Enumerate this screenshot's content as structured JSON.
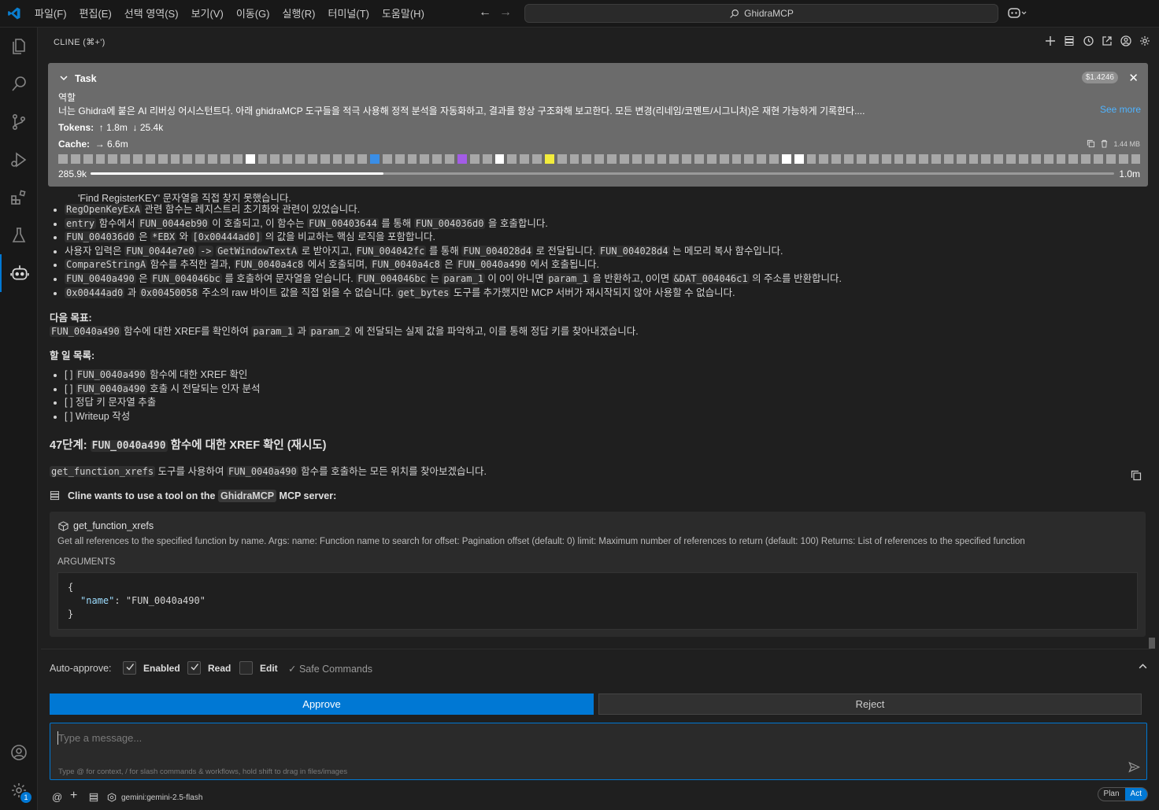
{
  "titlebar": {
    "menu": [
      "파일(F)",
      "편집(E)",
      "선택 영역(S)",
      "보기(V)",
      "이동(G)",
      "실행(R)",
      "터미널(T)",
      "도움말(H)"
    ],
    "search_text": "GhidraMCP"
  },
  "panel": {
    "title": "CLINE (⌘+')"
  },
  "task": {
    "title": "Task",
    "cost": "$1.4246",
    "role_label": "역할",
    "description": "너는 Ghidra에 붙은 AI 리버싱 어시스턴트다. 아래 ghidraMCP 도구들을 적극 사용해 정적 분석을 자동화하고, 결과를 항상 구조화해 보고한다. 모든 변경(리네임/코멘트/시그니처)은 재현 가능하게 기록한다....",
    "see_more": "See more",
    "tokens_label": "Tokens:",
    "tokens_up": "1.8m",
    "tokens_down": "25.4k",
    "cache_label": "Cache:",
    "cache_value": "6.6m",
    "size": "1.44 MB",
    "progress_left": "285.9k",
    "progress_right": "1.0m",
    "progress_fraction": 0.286,
    "block_colors": {
      "white": [
        15,
        35,
        58,
        59
      ],
      "blue": 25,
      "purple": 32,
      "yellow": 39
    }
  },
  "chat": {
    "truncated_line": "'Find RegisterKEY' 문자열을 직접 찾지 못했습니다.",
    "bullets": [
      [
        {
          "c": "RegOpenKeyExA"
        },
        {
          "t": " 관련 함수는 레지스트리 초기화와 관련이 있었습니다."
        }
      ],
      [
        {
          "c": "entry"
        },
        {
          "t": " 함수에서 "
        },
        {
          "c": "FUN_0044eb90"
        },
        {
          "t": " 이 호출되고, 이 함수는 "
        },
        {
          "c": "FUN_00403644"
        },
        {
          "t": " 를 통해 "
        },
        {
          "c": "FUN_004036d0"
        },
        {
          "t": " 을 호출합니다."
        }
      ],
      [
        {
          "c": "FUN_004036d0"
        },
        {
          "t": " 은 "
        },
        {
          "c": "*EBX"
        },
        {
          "t": " 와 "
        },
        {
          "c": "[0x00444ad0]"
        },
        {
          "t": " 의 값을 비교하는 핵심 로직을 포함합니다."
        }
      ],
      [
        {
          "t": "사용자 입력은 "
        },
        {
          "c": "FUN_0044e7e0"
        },
        {
          "t": " "
        },
        {
          "c": "->"
        },
        {
          "t": " "
        },
        {
          "c": "GetWindowTextA"
        },
        {
          "t": " 로 받아지고, "
        },
        {
          "c": "FUN_004042fc"
        },
        {
          "t": " 를 통해 "
        },
        {
          "c": "FUN_004028d4"
        },
        {
          "t": " 로 전달됩니다. "
        },
        {
          "c": "FUN_004028d4"
        },
        {
          "t": " 는 메모리 복사 함수입니다."
        }
      ],
      [
        {
          "c": "CompareStringA"
        },
        {
          "t": " 함수를 추적한 결과, "
        },
        {
          "c": "FUN_0040a4c8"
        },
        {
          "t": " 에서 호출되며, "
        },
        {
          "c": "FUN_0040a4c8"
        },
        {
          "t": " 은 "
        },
        {
          "c": "FUN_0040a490"
        },
        {
          "t": " 에서 호출됩니다."
        }
      ],
      [
        {
          "c": "FUN_0040a490"
        },
        {
          "t": " 은 "
        },
        {
          "c": "FUN_004046bc"
        },
        {
          "t": " 를 호출하여 문자열을 얻습니다. "
        },
        {
          "c": "FUN_004046bc"
        },
        {
          "t": " 는 "
        },
        {
          "c": "param_1"
        },
        {
          "t": " 이 0이 아니면 "
        },
        {
          "c": "param_1"
        },
        {
          "t": " 을 반환하고, 0이면 "
        },
        {
          "c": "&DAT_004046c1"
        },
        {
          "t": " 의 주소를 반환합니다."
        }
      ],
      [
        {
          "c": "0x00444ad0"
        },
        {
          "t": " 과 "
        },
        {
          "c": "0x00450058"
        },
        {
          "t": " 주소의 raw 바이트 값을 직접 읽을 수 없습니다. "
        },
        {
          "c": "get_bytes"
        },
        {
          "t": " 도구를 추가했지만 MCP 서버가 재시작되지 않아 사용할 수 없습니다."
        }
      ]
    ],
    "next_goal_heading": "다음 목표:",
    "next_goal": [
      {
        "c": "FUN_0040a490"
      },
      {
        "t": " 함수에 대한 XREF를 확인하여 "
      },
      {
        "c": "param_1"
      },
      {
        "t": " 과 "
      },
      {
        "c": "param_2"
      },
      {
        "t": " 에 전달되는 실제 값을 파악하고, 이를 통해 정답 키를 찾아내겠습니다."
      }
    ],
    "todo_heading": "할 일 목록:",
    "todos": [
      [
        {
          "t": "[ ] "
        },
        {
          "c": "FUN_0040a490"
        },
        {
          "t": " 함수에 대한 XREF 확인"
        }
      ],
      [
        {
          "t": "[ ] "
        },
        {
          "c": "FUN_0040a490"
        },
        {
          "t": " 호출 시 전달되는 인자 분석"
        }
      ],
      [
        {
          "t": "[ ] 정답 키 문자열 추출"
        }
      ],
      [
        {
          "t": "[ ] Writeup 작성"
        }
      ]
    ],
    "step_prefix": "47단계: ",
    "step_code": "FUN_0040a490",
    "step_suffix": " 함수에 대한 XREF 확인 (재시도)",
    "step_desc": [
      {
        "c": "get_function_xrefs"
      },
      {
        "t": " 도구를 사용하여 "
      },
      {
        "c": "FUN_0040a490"
      },
      {
        "t": " 함수를 호출하는 모든 위치를 찾아보겠습니다."
      }
    ],
    "tool_intro_pre": "Cline wants to use a tool on the ",
    "tool_intro_server": "GhidraMCP",
    "tool_intro_post": " MCP server:",
    "tool_name": "get_function_xrefs",
    "tool_desc": "Get all references to the specified function by name. Args: name: Function name to search for offset: Pagination offset (default: 0) limit: Maximum number of references to return (default: 100) Returns: List of references to the specified function",
    "arguments_label": "ARGUMENTS",
    "json_open": "{",
    "json_key": "\"name\"",
    "json_sep": ": ",
    "json_value": "\"FUN_0040a490\"",
    "json_close": "}"
  },
  "auto_approve": {
    "label": "Auto-approve:",
    "items": [
      {
        "label": "Enabled",
        "checked": true
      },
      {
        "label": "Read",
        "checked": true
      },
      {
        "label": "Edit",
        "checked": false
      }
    ],
    "safe_label": "✓ Safe Commands"
  },
  "buttons": {
    "approve": "Approve",
    "reject": "Reject"
  },
  "message": {
    "placeholder": "Type a message...",
    "hint": "Type @ for context, / for slash commands & workflows, hold shift to drag in files/images"
  },
  "bottom": {
    "model": "gemini:gemini-2.5-flash",
    "plan": "Plan",
    "act": "Act",
    "badge": "1"
  },
  "colors": {
    "accent": "#0078d4",
    "task_bg": "#6b6b6b",
    "block_blue": "#3a8ee6",
    "block_purple": "#a35ce6",
    "block_yellow": "#f2ec3c"
  }
}
